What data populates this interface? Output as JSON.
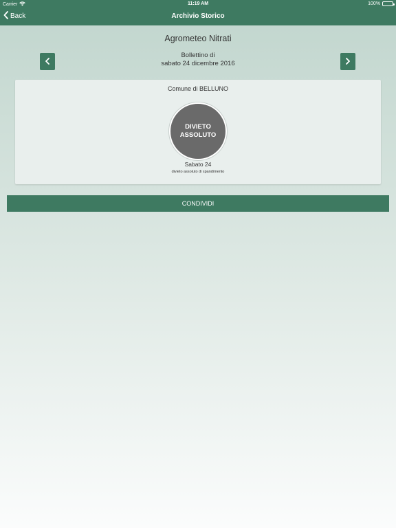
{
  "statusbar": {
    "carrier": "Carrier",
    "time": "11:19 AM",
    "battery": "100%"
  },
  "navbar": {
    "back_label": "Back",
    "title": "Archivio Storico"
  },
  "page": {
    "title": "Agrometeo Nitrati",
    "bulletin_line1": "Bollettino di",
    "bulletin_line2": "sabato 24 dicembre 2016"
  },
  "card": {
    "comune": "Comune di BELLUNO",
    "status_line1": "DIVIETO",
    "status_line2": "ASSOLUTO",
    "day": "Sabato 24",
    "description": "divieto assoluto di spandimento",
    "status_color": "#6a6a6a"
  },
  "actions": {
    "share_label": "CONDIVIDI"
  },
  "colors": {
    "brand": "#3e7a61"
  },
  "icons": {
    "prev": "chevron-left-icon",
    "next": "chevron-right-icon",
    "back": "chevron-left-icon",
    "wifi": "wifi-icon",
    "battery": "battery-icon"
  }
}
